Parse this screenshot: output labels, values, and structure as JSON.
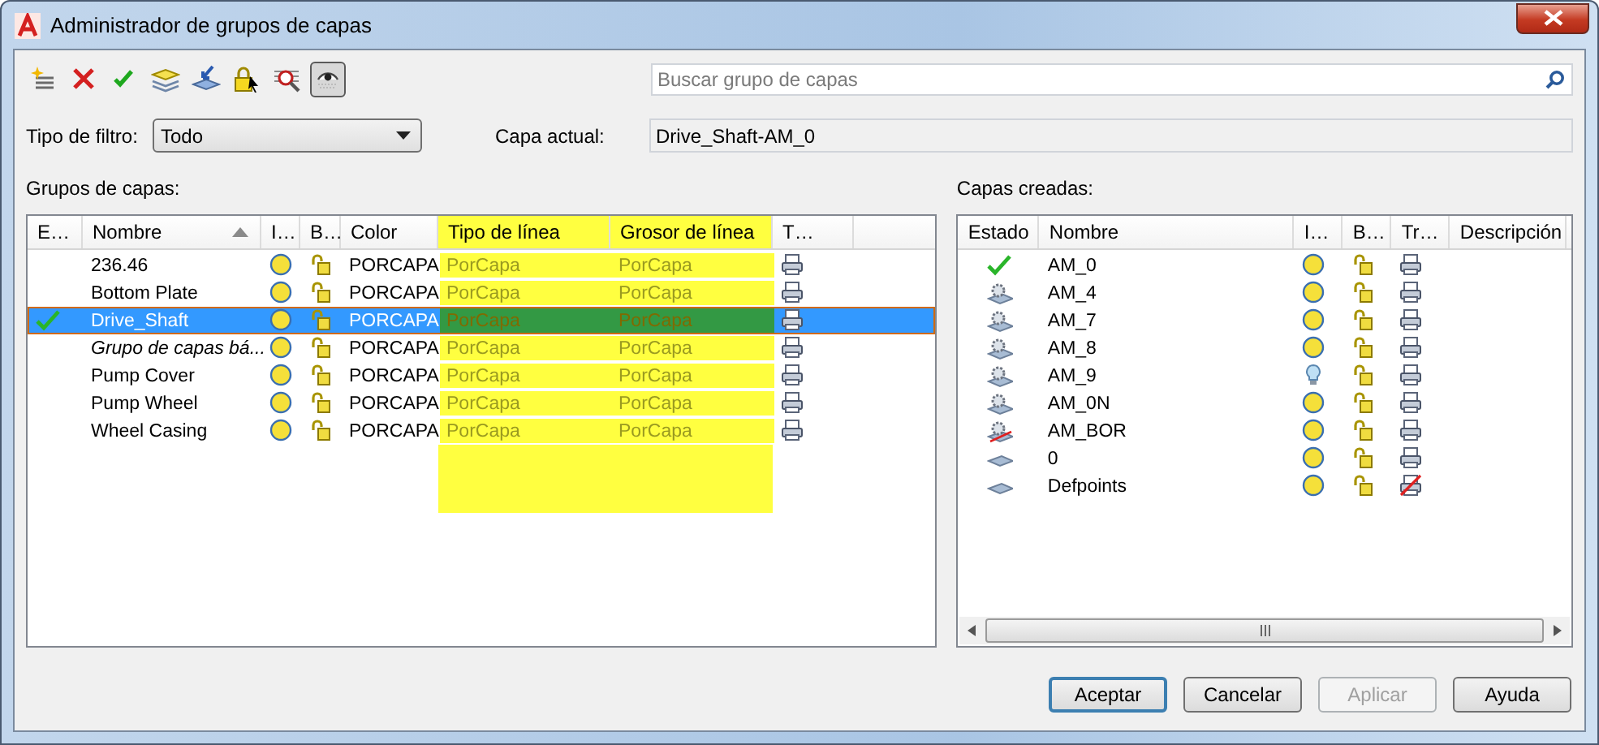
{
  "window": {
    "title": "Administrador de grupos de capas"
  },
  "toolbar": [
    {
      "kind": "new-group",
      "pressed": false
    },
    {
      "kind": "delete",
      "pressed": false
    },
    {
      "kind": "set-current",
      "pressed": false
    },
    {
      "kind": "layers",
      "pressed": false
    },
    {
      "kind": "import",
      "pressed": false
    },
    {
      "kind": "lock",
      "pressed": false
    },
    {
      "kind": "find",
      "pressed": false
    },
    {
      "kind": "visibility",
      "pressed": true
    }
  ],
  "search": {
    "placeholder": "Buscar grupo de capas"
  },
  "filter": {
    "label": "Tipo de filtro:",
    "value": "Todo"
  },
  "current_layer": {
    "label": "Capa actual:",
    "value": "Drive_Shaft-AM_0"
  },
  "groups": {
    "title": "Grupos de capas:",
    "columns": [
      {
        "label": "E…",
        "highlighted": false,
        "sorted": false
      },
      {
        "label": "Nombre",
        "highlighted": false,
        "sorted": true
      },
      {
        "label": "I…",
        "highlighted": false,
        "sorted": false
      },
      {
        "label": "B…",
        "highlighted": false,
        "sorted": false
      },
      {
        "label": "Color",
        "highlighted": false,
        "sorted": false
      },
      {
        "label": "Tipo de línea",
        "highlighted": true,
        "sorted": false
      },
      {
        "label": "Grosor de línea",
        "highlighted": true,
        "sorted": false
      },
      {
        "label": "T…",
        "highlighted": false,
        "sorted": false
      }
    ],
    "rows": [
      {
        "current": false,
        "kind": "group",
        "name": "236.46",
        "on": true,
        "color_setting": "PORCAPA",
        "linetype": "PorCapa",
        "lineweight": "PorCapa",
        "selected": false
      },
      {
        "current": false,
        "kind": "group",
        "name": "Bottom Plate",
        "on": true,
        "color_setting": "PORCAPA",
        "linetype": "PorCapa",
        "lineweight": "PorCapa",
        "selected": false
      },
      {
        "current": true,
        "kind": "group",
        "name": "Drive_Shaft",
        "on": true,
        "color_setting": "PORCAPA",
        "linetype": "PorCapa",
        "lineweight": "PorCapa",
        "selected": true
      },
      {
        "current": false,
        "kind": "default",
        "name": "Grupo de capas bá...",
        "on": true,
        "color_setting": "PORCAPA",
        "linetype": "PorCapa",
        "lineweight": "PorCapa",
        "selected": false
      },
      {
        "current": false,
        "kind": "group",
        "name": "Pump Cover",
        "on": true,
        "color_setting": "PORCAPA",
        "linetype": "PorCapa",
        "lineweight": "PorCapa",
        "selected": false
      },
      {
        "current": false,
        "kind": "group",
        "name": "Pump Wheel",
        "on": true,
        "color_setting": "PORCAPA",
        "linetype": "PorCapa",
        "lineweight": "PorCapa",
        "selected": false
      },
      {
        "current": false,
        "kind": "group",
        "name": "Wheel Casing",
        "on": true,
        "color_setting": "PORCAPA",
        "linetype": "PorCapa",
        "lineweight": "PorCapa",
        "selected": false
      }
    ]
  },
  "layers": {
    "title": "Capas creadas:",
    "columns": [
      {
        "label": "Estado"
      },
      {
        "label": "Nombre"
      },
      {
        "label": "I…"
      },
      {
        "label": "B…"
      },
      {
        "label": "Tr…"
      },
      {
        "label": "Descripción"
      }
    ],
    "rows": [
      {
        "kind": "current",
        "name": "AM_0",
        "on": true,
        "plot": true
      },
      {
        "kind": "group",
        "name": "AM_4",
        "on": true,
        "plot": true
      },
      {
        "kind": "group",
        "name": "AM_7",
        "on": true,
        "plot": true
      },
      {
        "kind": "group",
        "name": "AM_8",
        "on": true,
        "plot": true
      },
      {
        "kind": "group",
        "name": "AM_9",
        "on": false,
        "plot": true
      },
      {
        "kind": "group",
        "name": "AM_0N",
        "on": true,
        "plot": true
      },
      {
        "kind": "group-unused",
        "name": "AM_BOR",
        "on": true,
        "plot": true
      },
      {
        "kind": "layer",
        "name": "0",
        "on": true,
        "plot": true
      },
      {
        "kind": "layer",
        "name": "Defpoints",
        "on": true,
        "plot": false
      }
    ]
  },
  "buttons": [
    {
      "label": "Aceptar",
      "default": true,
      "disabled": false
    },
    {
      "label": "Cancelar",
      "default": false,
      "disabled": false
    },
    {
      "label": "Aplicar",
      "default": false,
      "disabled": true
    },
    {
      "label": "Ayuda",
      "default": false,
      "disabled": false
    }
  ]
}
